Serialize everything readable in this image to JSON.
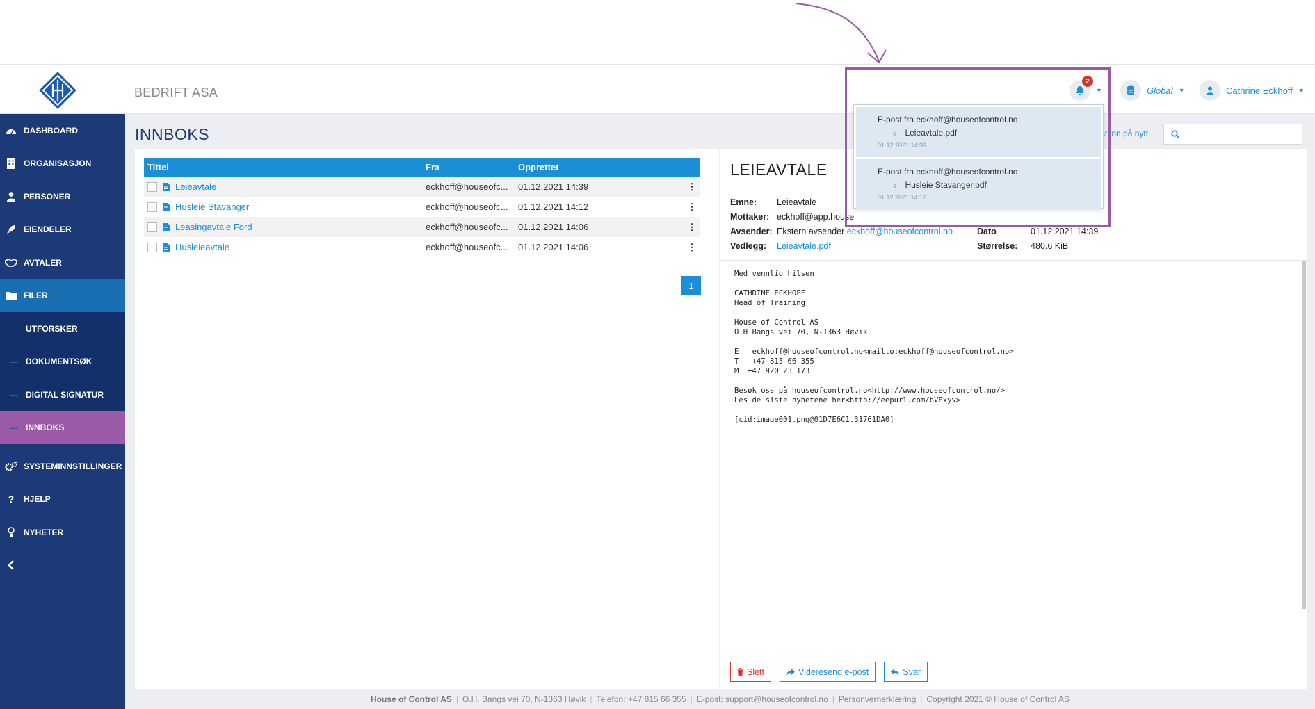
{
  "header": {
    "company": "BEDRIFT ASA",
    "notification_count": "2",
    "scope_label": "Global",
    "user_name": "Cathrine Eckhoff"
  },
  "sidebar": {
    "items": [
      {
        "label": "DASHBOARD",
        "icon": "dashboard-icon"
      },
      {
        "label": "ORGANISASJON",
        "icon": "building-icon"
      },
      {
        "label": "PERSONER",
        "icon": "person-icon"
      },
      {
        "label": "EIENDELER",
        "icon": "rocket-icon"
      },
      {
        "label": "AVTALER",
        "icon": "handshake-icon"
      },
      {
        "label": "FILER",
        "icon": "folder-icon"
      }
    ],
    "sub_items": [
      {
        "label": "UTFORSKER"
      },
      {
        "label": "DOKUMENTSØK"
      },
      {
        "label": "DIGITAL SIGNATUR"
      },
      {
        "label": "INNBOKS"
      }
    ],
    "bottom_items": [
      {
        "label": "SYSTEMINNSTILLINGER",
        "icon": "gears-icon"
      },
      {
        "label": "HJELP",
        "icon": "question-icon"
      },
      {
        "label": "NYHETER",
        "icon": "lightbulb-icon"
      }
    ]
  },
  "main": {
    "title": "INNBOKS",
    "reload_link": "st inn på nytt",
    "search_placeholder": "",
    "table": {
      "headers": [
        "Tittel",
        "Fra",
        "Opprettet"
      ],
      "rows": [
        {
          "title": "Leieavtale",
          "from": "eckhoff@houseofc...",
          "created": "01.12.2021 14:39"
        },
        {
          "title": "Husleie Stavanger",
          "from": "eckhoff@houseofc...",
          "created": "01.12.2021 14:12"
        },
        {
          "title": "Leasingavtale Ford",
          "from": "eckhoff@houseofc...",
          "created": "01.12.2021 14:06"
        },
        {
          "title": "Husleieavtale",
          "from": "eckhoff@houseofc...",
          "created": "01.12.2021 14:06"
        }
      ]
    },
    "page": "1"
  },
  "detail": {
    "title": "LEIEAVTALE",
    "emne_label": "Emne:",
    "emne_value": "Leieavtale",
    "mottaker_label": "Mottaker:",
    "mottaker_value": "eckhoff@app.house",
    "avsender_label": "Avsender:",
    "avsender_value": "Ekstern avsender",
    "avsender_email": "eckhoff@houseofcontrol.no",
    "dato_label": "Dato",
    "dato_value": "01.12.2021 14:39",
    "vedlegg_label": "Vedlegg:",
    "vedlegg_value": "Leieavtale.pdf",
    "storrelse_label": "Størrelse:",
    "storrelse_value": "480.6 KiB",
    "body": "Med vennlig hilsen\n\nCATHRINE ECKHOFF\nHead of Training\n\nHouse of Control AS\nO.H Bangs vei 70, N-1363 Høvik\n\nE   eckhoff@houseofcontrol.no<mailto:eckhoff@houseofcontrol.no>\nT   +47 815 66 355\nM  +47 920 23 173\n\nBesøk oss på houseofcontrol.no<http://www.houseofcontrol.no/>\nLes de siste nyhetene her<http://eepurl.com/bVExyv>\n\n[cid:image001.png@01D7E6C1.31761DA0]",
    "btn_delete": "Slett",
    "btn_forward": "Videresend e-post",
    "btn_reply": "Svar"
  },
  "notifications": [
    {
      "title": "E-post fra eckhoff@houseofcontrol.no",
      "file": "Leieavtale.pdf",
      "date": "01.12.2021 14:39"
    },
    {
      "title": "E-post fra eckhoff@houseofcontrol.no",
      "file": "Husleie Stavanger.pdf",
      "date": "01.12.2021 14:12"
    }
  ],
  "footer": {
    "company": "House of Control AS",
    "address": "O.H. Bangs vei 70, N-1363 Høvik",
    "phone": "Telefon: +47 815 66 355",
    "email": "E-post: support@houseofcontrol.no",
    "privacy": "Personvernerklæring",
    "copyright": "Copyright 2021 © House of Control AS"
  },
  "colors": {
    "sidebar": "#1c3a78",
    "accent": "#1a8ed6",
    "active_sub": "#9b5aa7",
    "highlight": "#9b5aa7"
  }
}
